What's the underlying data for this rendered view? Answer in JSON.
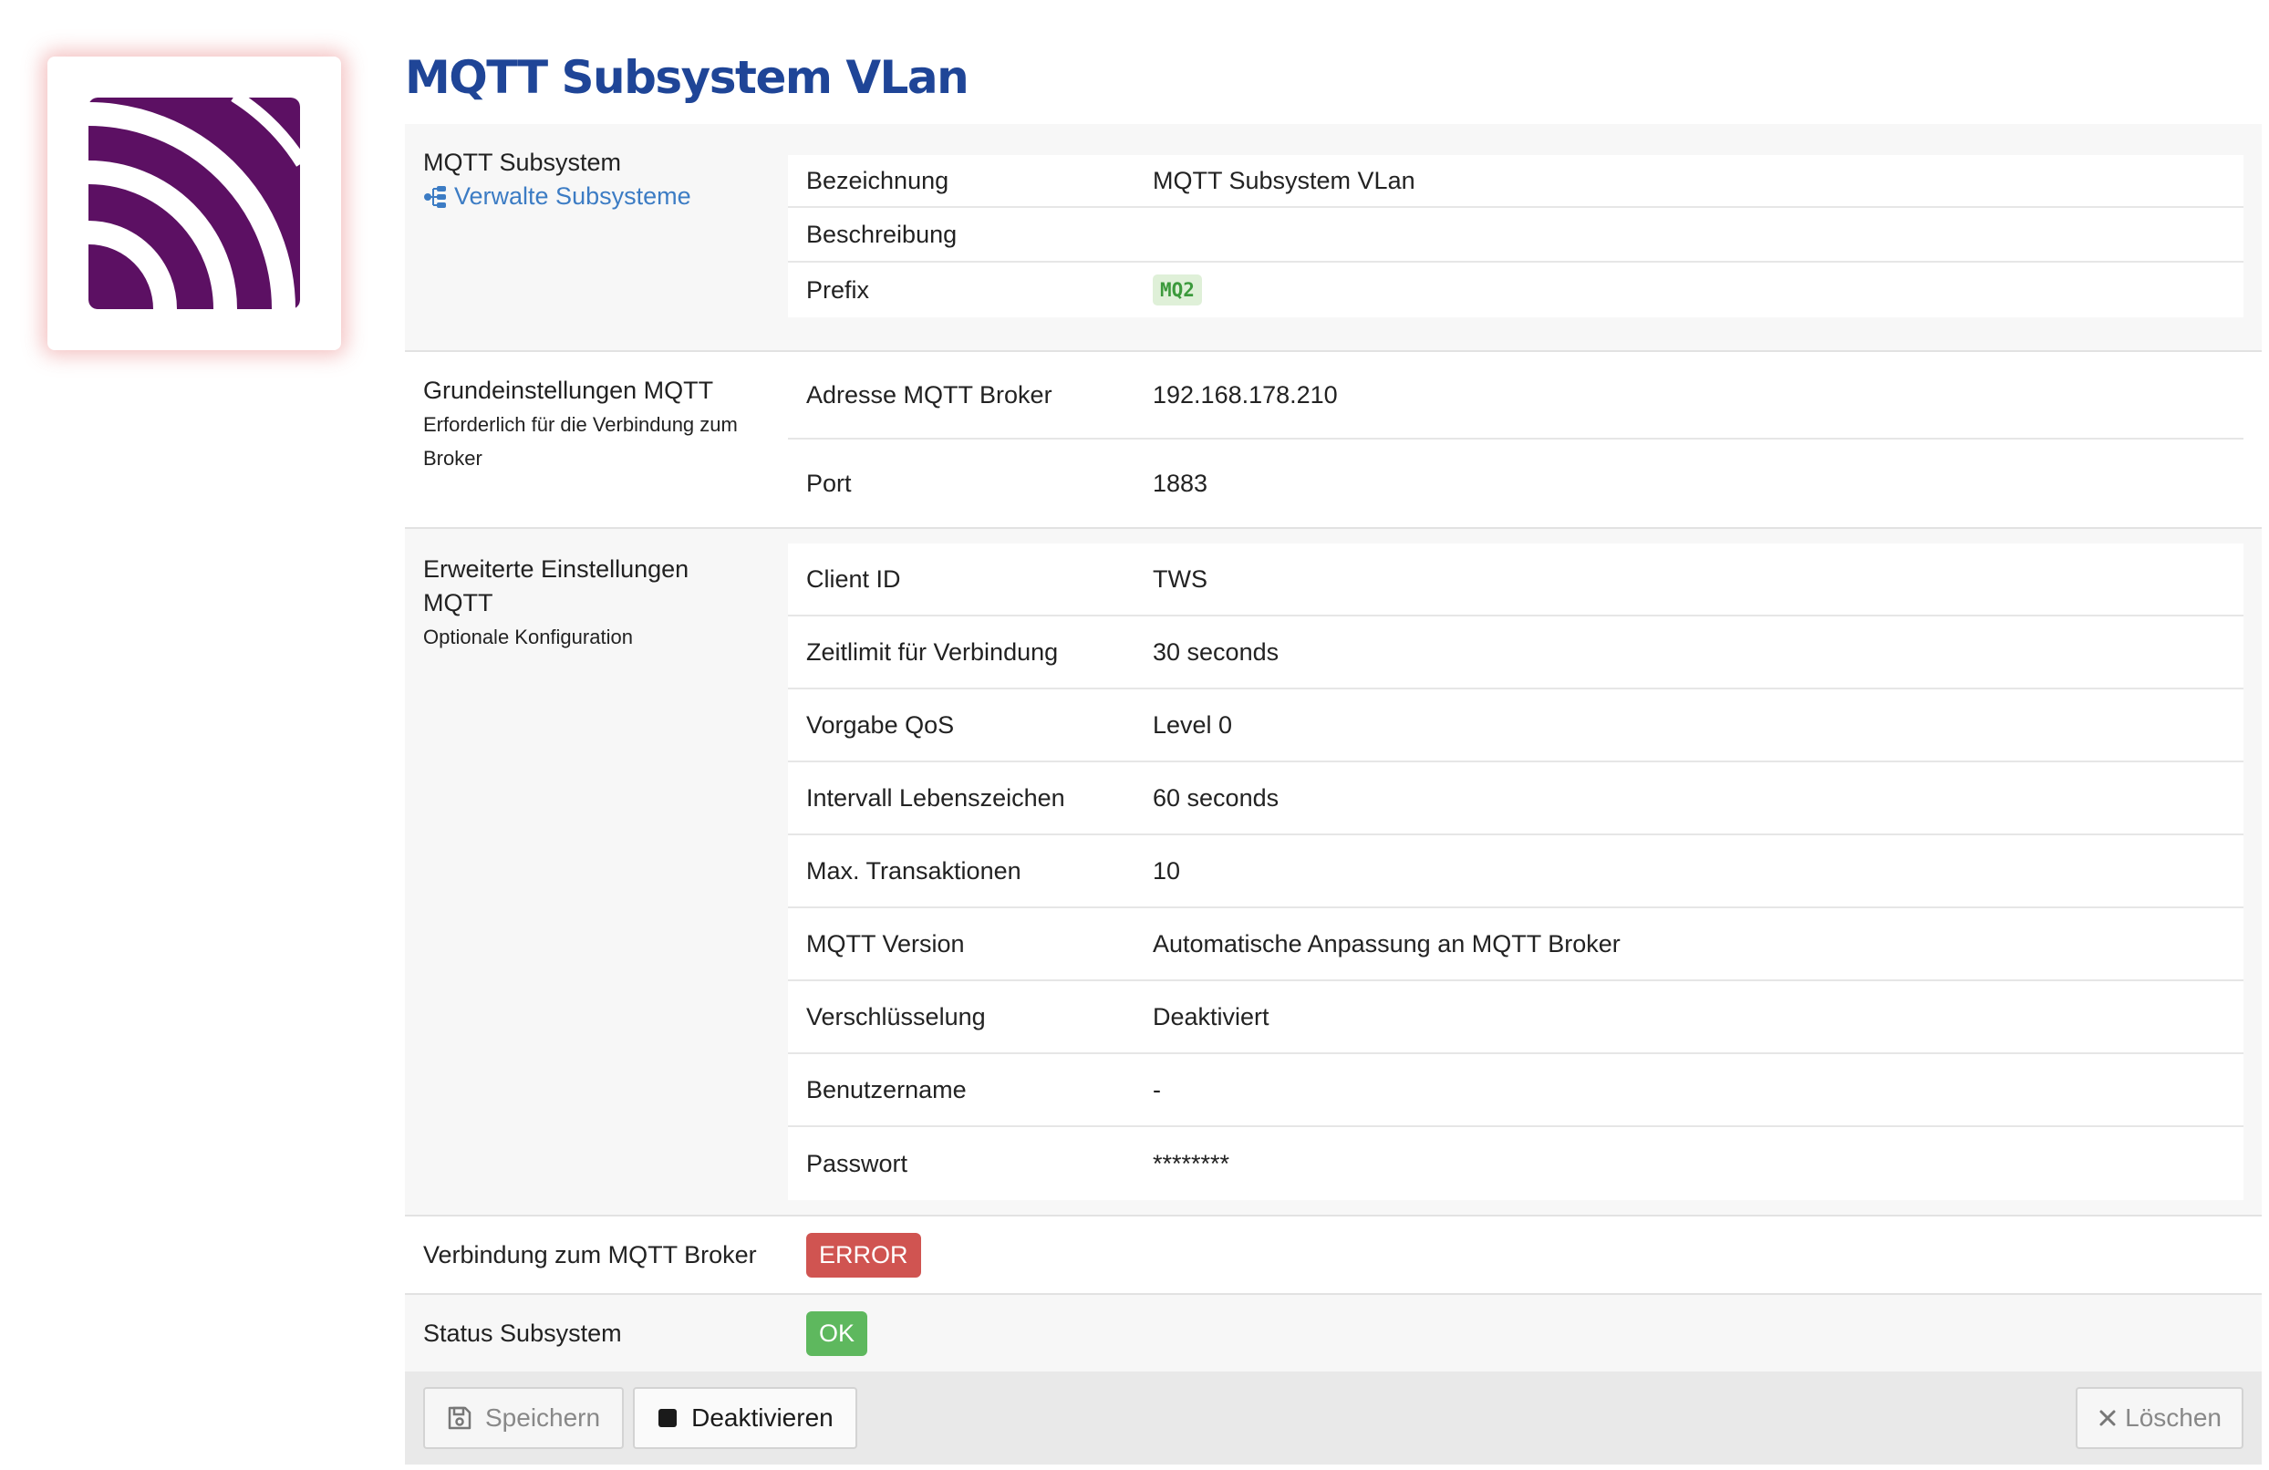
{
  "title": "MQTT Subsystem VLan",
  "logo_icon": "mqtt-logo-icon",
  "colors": {
    "brand": "#5c1063",
    "title": "#1f4597",
    "link": "#3c7cc4",
    "error": "#d05451",
    "ok": "#5eb85e"
  },
  "section1": {
    "title": "MQTT Subsystem",
    "link": "Verwalte Subsysteme",
    "link_icon": "sitemap-icon",
    "rows": [
      {
        "key": "Bezeichnung",
        "value": "MQTT Subsystem VLan"
      },
      {
        "key": "Beschreibung",
        "value": ""
      },
      {
        "key": "Prefix",
        "value": "MQ2"
      }
    ]
  },
  "section2": {
    "title": "Grundeinstellungen MQTT",
    "subtitle": "Erforderlich für die Verbindung zum Broker",
    "rows": [
      {
        "key": "Adresse MQTT Broker",
        "value": "192.168.178.210"
      },
      {
        "key": "Port",
        "value": "1883"
      }
    ]
  },
  "section3": {
    "title": "Erweiterte Einstellungen MQTT",
    "subtitle": "Optionale Konfiguration",
    "rows": [
      {
        "key": "Client ID",
        "value": "TWS"
      },
      {
        "key": "Zeitlimit für Verbindung",
        "value": "30 seconds"
      },
      {
        "key": "Vorgabe QoS",
        "value": "Level 0"
      },
      {
        "key": "Intervall Lebenszeichen",
        "value": "60 seconds"
      },
      {
        "key": "Max. Transaktionen",
        "value": "10"
      },
      {
        "key": "MQTT Version",
        "value": "Automatische Anpassung an MQTT Broker"
      },
      {
        "key": "Verschlüsselung",
        "value": "Deaktiviert"
      },
      {
        "key": "Benutzername",
        "value": "-"
      },
      {
        "key": "Passwort",
        "value": "********"
      }
    ]
  },
  "connection": {
    "label": "Verbindung zum MQTT Broker",
    "status": "ERROR"
  },
  "subsystem_status": {
    "label": "Status Subsystem",
    "status": "OK"
  },
  "toolbar": {
    "save_label": "Speichern",
    "save_icon": "floppy-disk-icon",
    "deactivate_label": "Deaktivieren",
    "deactivate_icon": "stop-icon",
    "delete_label": "Löschen",
    "delete_icon": "close-icon"
  }
}
